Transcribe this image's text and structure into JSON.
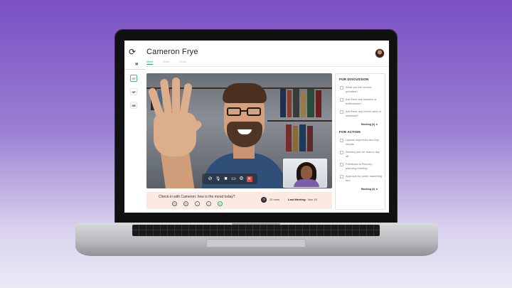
{
  "app": {
    "title": "Cameron Frye",
    "tabs": [
      {
        "label": "Meet",
        "active": true
      },
      {
        "label": "Work",
        "active": false
      },
      {
        "label": "Grow",
        "active": false
      }
    ],
    "sidebar": {
      "items": [
        {
          "label": "CF",
          "active": true
        },
        {
          "label": "SP",
          "active": false
        },
        {
          "label": "SR",
          "active": false
        }
      ]
    },
    "accent_color": "#2aa56b"
  },
  "video": {
    "controls": [
      {
        "icon": "screen-share-off-icon",
        "glyph": "⊘"
      },
      {
        "icon": "microphone-icon",
        "glyph": "🎙"
      },
      {
        "icon": "camera-icon",
        "glyph": "■"
      },
      {
        "icon": "chat-icon",
        "glyph": "▭"
      },
      {
        "icon": "settings-icon",
        "glyph": "⚙"
      },
      {
        "icon": "end-call-icon",
        "glyph": "✕"
      }
    ]
  },
  "checkin": {
    "prompt": "Check-in with Cameron: how is the mood today?",
    "moods": [
      {
        "icon": "very-sad-face-icon",
        "glyph": "☹",
        "selected": false
      },
      {
        "icon": "sad-face-icon",
        "glyph": "☹",
        "selected": false
      },
      {
        "icon": "neutral-face-icon",
        "glyph": "•",
        "selected": false
      },
      {
        "icon": "happy-face-icon",
        "glyph": "☺",
        "selected": false
      },
      {
        "icon": "very-happy-face-icon",
        "glyph": "☺",
        "selected": true
      }
    ],
    "timer": "22 mins",
    "last_meeting_label": "Last Meeting:",
    "last_meeting_value": "Nov 15"
  },
  "panel": {
    "discussion": {
      "title": "FOR DISCUSSION",
      "items": [
        "What are the current priorities?",
        "Are there any barriers or bottlenecks?",
        "Are there any recent wins or setbacks?"
      ],
      "backlog": "Backlog (4) ⏶"
    },
    "action": {
      "title": "FOR ACTION",
      "items": [
        "Update objectives and key results",
        "Review plan for team's day off",
        "Feedback to Rooney - planning meeting",
        "Approval for junior marketing hire"
      ],
      "backlog": "Backlog (4) ⏶"
    }
  }
}
